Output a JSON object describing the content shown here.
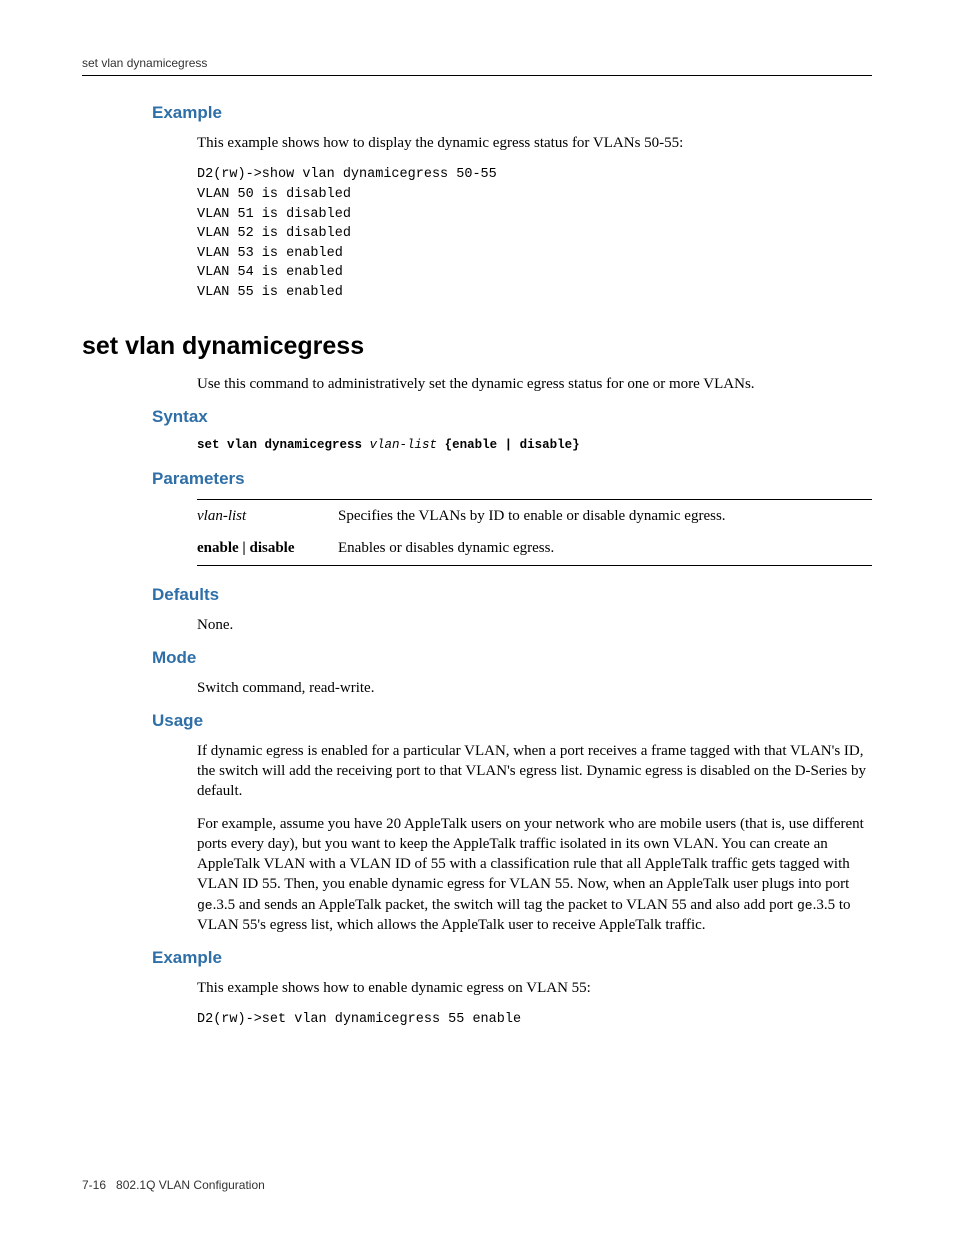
{
  "header": {
    "running_head": "set vlan dynamicegress"
  },
  "section1": {
    "example_head": "Example",
    "example_intro": "This example shows how to display the dynamic egress status for VLANs 50-55:",
    "code": "D2(rw)->show vlan dynamicegress 50-55\nVLAN 50 is disabled\nVLAN 51 is disabled\nVLAN 52 is disabled\nVLAN 53 is enabled\nVLAN 54 is enabled\nVLAN 55 is enabled"
  },
  "cmd": {
    "title": "set vlan dynamicegress",
    "desc": "Use this command to administratively set the dynamic egress status for one or more VLANs.",
    "syntax_head": "Syntax",
    "syntax_bold1": "set vlan dynamicegress",
    "syntax_ital": "vlan-list",
    "syntax_bold2": "{enable | disable}",
    "params_head": "Parameters",
    "params": [
      {
        "key_ital": "vlan-list",
        "key_bold": "",
        "desc": "Specifies the VLANs by ID to enable or disable dynamic egress."
      },
      {
        "key_ital": "",
        "key_bold": "enable | disable",
        "desc": "Enables or disables dynamic egress."
      }
    ],
    "defaults_head": "Defaults",
    "defaults_body": "None.",
    "mode_head": "Mode",
    "mode_body": "Switch command, read-write.",
    "usage_head": "Usage",
    "usage_p1": "If dynamic egress is enabled for a particular VLAN, when a port receives a frame tagged with that VLAN's ID, the switch will add the receiving port to that VLAN's egress list. Dynamic egress is disabled on the D-Series by default.",
    "usage_p2a": "For example, assume you have 20 AppleTalk users on your network who are mobile users (that is, use different ports every day), but you want to keep the AppleTalk traffic isolated in its own VLAN. You can create an AppleTalk VLAN with a VLAN ID of 55 with a classification rule that all AppleTalk traffic gets tagged with VLAN ID 55. Then, you enable dynamic egress for VLAN 55. Now, when an AppleTalk user plugs into port ",
    "usage_port1": "ge",
    "usage_p2b": ".3.5 and sends an AppleTalk packet, the switch will tag the packet to VLAN 55 and also add port ",
    "usage_port2": "ge",
    "usage_p2c": ".3.5 to VLAN 55's egress list, which allows the AppleTalk user to receive AppleTalk traffic.",
    "example_head": "Example",
    "example_intro": "This example shows how to enable dynamic egress on VLAN 55:",
    "example_code": "D2(rw)->set vlan dynamicegress 55 enable"
  },
  "footer": {
    "page": "7-16",
    "label": "802.1Q VLAN Configuration"
  }
}
